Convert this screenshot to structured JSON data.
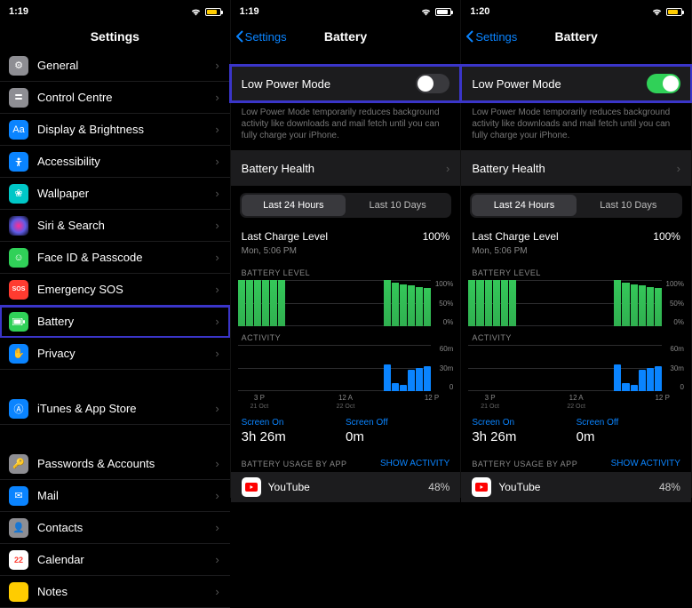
{
  "screen1": {
    "time": "1:19",
    "battery_color": "#ffcc00",
    "battery_fill": "70%",
    "title": "Settings",
    "items": [
      {
        "label": "General",
        "icon_bg": "#8e8e93",
        "icon": "gear"
      },
      {
        "label": "Control Centre",
        "icon_bg": "#8e8e93",
        "icon": "sliders"
      },
      {
        "label": "Display & Brightness",
        "icon_bg": "#0a84ff",
        "icon": "display"
      },
      {
        "label": "Accessibility",
        "icon_bg": "#0a84ff",
        "icon": "person"
      },
      {
        "label": "Wallpaper",
        "icon_bg": "#00c7c7",
        "icon": "wallpaper"
      },
      {
        "label": "Siri & Search",
        "icon_bg": "#000",
        "icon": "siri"
      },
      {
        "label": "Face ID & Passcode",
        "icon_bg": "#30d158",
        "icon": "face"
      },
      {
        "label": "Emergency SOS",
        "icon_bg": "#ff3b30",
        "icon": "sos"
      },
      {
        "label": "Battery",
        "icon_bg": "#30d158",
        "icon": "battery",
        "highlight": true
      },
      {
        "label": "Privacy",
        "icon_bg": "#0a84ff",
        "icon": "hand"
      }
    ],
    "items2": [
      {
        "label": "iTunes & App Store",
        "icon_bg": "#0a84ff",
        "icon": "appstore"
      }
    ],
    "items3": [
      {
        "label": "Passwords & Accounts",
        "icon_bg": "#8e8e93",
        "icon": "key"
      },
      {
        "label": "Mail",
        "icon_bg": "#0a84ff",
        "icon": "mail"
      },
      {
        "label": "Contacts",
        "icon_bg": "#8e8e93",
        "icon": "contacts"
      },
      {
        "label": "Calendar",
        "icon_bg": "#ff3b30",
        "icon": "calendar"
      },
      {
        "label": "Notes",
        "icon_bg": "#ffcc00",
        "icon": "notes"
      }
    ]
  },
  "common_battery_page": {
    "back_label": "Settings",
    "title": "Battery",
    "low_power_label": "Low Power Mode",
    "low_power_desc": "Low Power Mode temporarily reduces background activity like downloads and mail fetch until you can fully charge your iPhone.",
    "health_label": "Battery Health",
    "seg_24h": "Last 24 Hours",
    "seg_10d": "Last 10 Days",
    "last_charge_label": "Last Charge Level",
    "last_charge_time": "Mon, 5:06 PM",
    "last_charge_pct": "100%",
    "battery_level_label": "BATTERY LEVEL",
    "y_100": "100%",
    "y_50": "50%",
    "y_0": "0%",
    "activity_label": "ACTIVITY",
    "act_60": "60m",
    "act_30": "30m",
    "act_0": "0",
    "xaxis": [
      "3 P",
      "",
      "12 A",
      "",
      "12 P"
    ],
    "xsub": [
      "21 Oct",
      "",
      "22 Oct",
      "",
      ""
    ],
    "screen_on_label": "Screen On",
    "screen_on_val": "3h 26m",
    "screen_off_label": "Screen Off",
    "screen_off_val": "0m",
    "usage_header": "BATTERY USAGE BY APP",
    "show_activity": "SHOW ACTIVITY",
    "app_name": "YouTube",
    "app_pct": "48%"
  },
  "screen2": {
    "time": "1:19",
    "battery_color": "#ffffff",
    "battery_fill": "70%",
    "toggle_on": false
  },
  "screen3": {
    "time": "1:20",
    "battery_color": "#ffcc00",
    "battery_fill": "70%",
    "toggle_on": true
  },
  "chart_data": {
    "type": "bar",
    "battery_level": {
      "xticks": [
        "3 P",
        "",
        "12 A",
        "",
        "12 P"
      ],
      "ylim": [
        0,
        100
      ],
      "values": [
        100,
        100,
        100,
        100,
        100,
        100,
        null,
        null,
        null,
        null,
        null,
        null,
        null,
        null,
        null,
        null,
        null,
        null,
        100,
        95,
        90,
        88,
        85,
        82
      ]
    },
    "activity": {
      "ylim": [
        0,
        60
      ],
      "values": [
        0,
        0,
        0,
        0,
        0,
        0,
        0,
        0,
        0,
        0,
        0,
        0,
        0,
        0,
        0,
        0,
        0,
        0,
        35,
        10,
        8,
        28,
        30,
        32
      ]
    }
  }
}
